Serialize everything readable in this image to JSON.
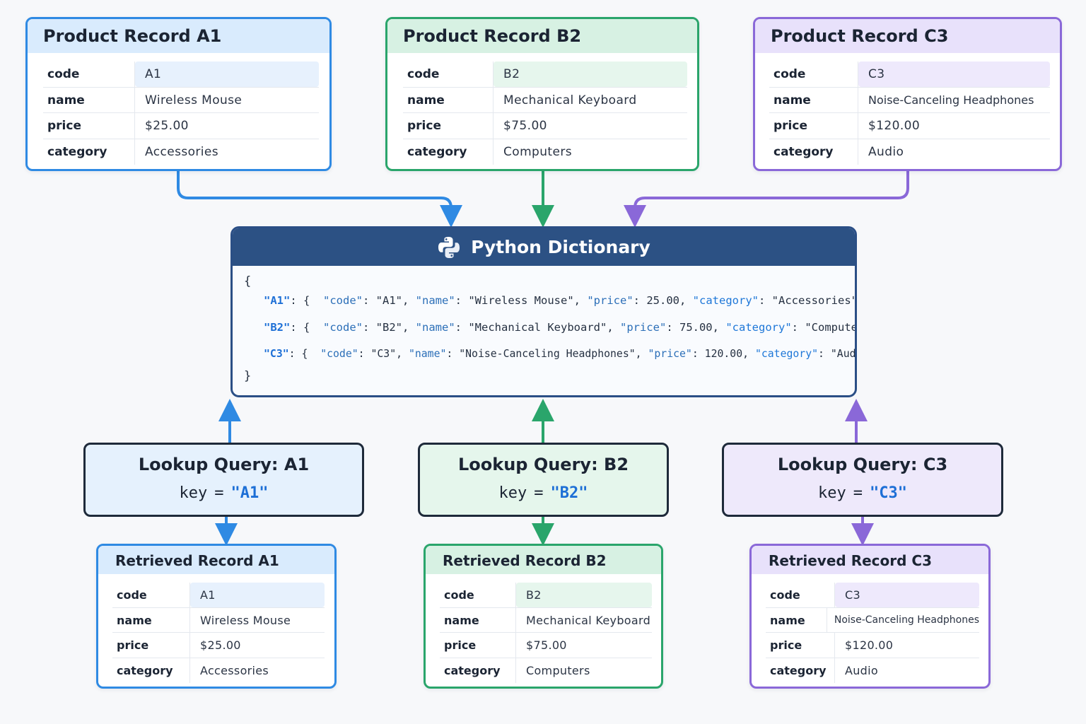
{
  "colors": {
    "blue": "#2f8ae3",
    "green": "#2aa56b",
    "purple": "#8a68d8",
    "dict_header": "#2c5184"
  },
  "records": [
    {
      "title": "Product Record A1",
      "fields": [
        {
          "key": "code",
          "value": "A1"
        },
        {
          "key": "name",
          "value": "Wireless Mouse"
        },
        {
          "key": "price",
          "value": "$25.00"
        },
        {
          "key": "category",
          "value": "Accessories"
        }
      ]
    },
    {
      "title": "Product Record B2",
      "fields": [
        {
          "key": "code",
          "value": "B2"
        },
        {
          "key": "name",
          "value": "Mechanical Keyboard"
        },
        {
          "key": "price",
          "value": "$75.00"
        },
        {
          "key": "category",
          "value": "Computers"
        }
      ]
    },
    {
      "title": "Product Record C3",
      "fields": [
        {
          "key": "code",
          "value": "C3"
        },
        {
          "key": "name",
          "value": "Noise-Canceling Headphones"
        },
        {
          "key": "price",
          "value": "$120.00"
        },
        {
          "key": "category",
          "value": "Audio"
        }
      ]
    }
  ],
  "dictionary": {
    "title": "Python Dictionary",
    "icon": "python-logo-icon",
    "open_brace": "{",
    "close_brace": "}",
    "entries": [
      {
        "key": "\"A1\"",
        "code_label": "\"code\"",
        "code": "\"A1\"",
        "name_label": "\"name\"",
        "name": "\"Wireless Mouse\"",
        "price_label": "\"price\"",
        "price": "25.00",
        "category_label": "\"category\"",
        "category": "\"Accessories\"",
        "trail": "},"
      },
      {
        "key": "\"B2\"",
        "code_label": "\"code\"",
        "code": "\"B2\"",
        "name_label": "\"name\"",
        "name": "\"Mechanical Keyboard\"",
        "price_label": "\"price\"",
        "price": "75.00",
        "category_label": "\"category\"",
        "category": "\"Computers\"",
        "trail": "},"
      },
      {
        "key": "\"C3\"",
        "code_label": "\"code\"",
        "code": "\"C3\"",
        "name_label": "\"name\"",
        "name": "\"Noise-Canceling Headphones\"",
        "price_label": "\"price\"",
        "price": "120.00",
        "category_label": "\"category\"",
        "category": "\"Audio\"",
        "trail": "}"
      }
    ]
  },
  "queries": [
    {
      "title": "Lookup Query: A1",
      "key_label": "key",
      "equals": "=",
      "key_value": "\"A1\""
    },
    {
      "title": "Lookup Query: B2",
      "key_label": "key",
      "equals": "=",
      "key_value": "\"B2\""
    },
    {
      "title": "Lookup Query: C3",
      "key_label": "key",
      "equals": "=",
      "key_value": "\"C3\""
    }
  ],
  "results": [
    {
      "title": "Retrieved Record A1",
      "fields": [
        {
          "key": "code",
          "value": "A1"
        },
        {
          "key": "name",
          "value": "Wireless Mouse"
        },
        {
          "key": "price",
          "value": "$25.00"
        },
        {
          "key": "category",
          "value": "Accessories"
        }
      ]
    },
    {
      "title": "Retrieved Record B2",
      "fields": [
        {
          "key": "code",
          "value": "B2"
        },
        {
          "key": "name",
          "value": "Mechanical Keyboard"
        },
        {
          "key": "price",
          "value": "$75.00"
        },
        {
          "key": "category",
          "value": "Computers"
        }
      ]
    },
    {
      "title": "Retrieved Record C3",
      "fields": [
        {
          "key": "code",
          "value": "C3"
        },
        {
          "key": "name",
          "value": "Noise-Canceling Headphones"
        },
        {
          "key": "price",
          "value": "$120.00"
        },
        {
          "key": "category",
          "value": "Audio"
        }
      ]
    }
  ]
}
